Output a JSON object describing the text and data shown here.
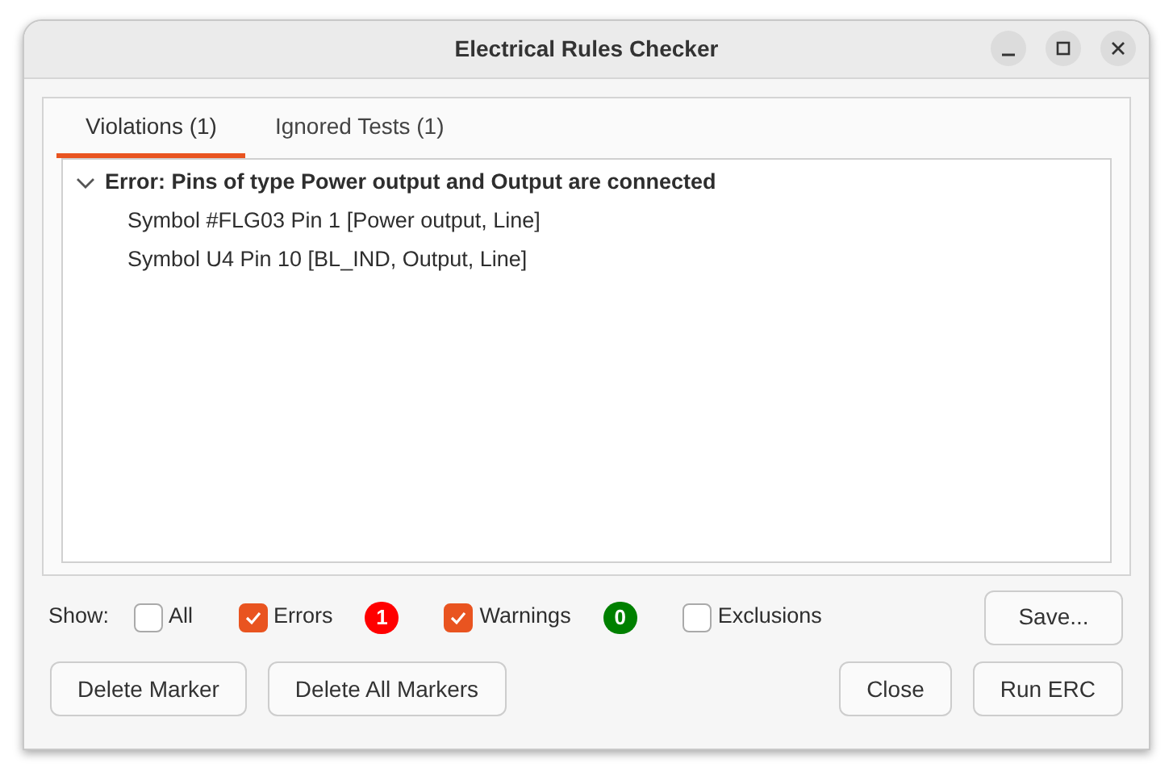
{
  "window": {
    "title": "Electrical Rules Checker"
  },
  "tabs": [
    {
      "label": "Violations (1)",
      "selected": true
    },
    {
      "label": "Ignored Tests (1)",
      "selected": false
    }
  ],
  "violations": [
    {
      "text": "Error: Pins of type Power output and Output are connected",
      "expanded": true,
      "children": [
        {
          "text": "Symbol #FLG03 Pin 1 [Power output, Line]"
        },
        {
          "text": "Symbol U4 Pin 10 [BL_IND, Output, Line]"
        }
      ]
    }
  ],
  "show_label": "Show:",
  "filters": [
    {
      "label": "All",
      "checked": false
    },
    {
      "label": "Errors",
      "checked": true,
      "count": "1",
      "color": "#ff0000"
    },
    {
      "label": "Warnings",
      "checked": true,
      "count": "0",
      "color": "#008000"
    },
    {
      "label": "Exclusions",
      "checked": false
    }
  ],
  "save_button": "Save...",
  "left_buttons": [
    "Delete Marker",
    "Delete All Markers"
  ],
  "right_buttons": [
    "Close",
    "Run ERC"
  ]
}
